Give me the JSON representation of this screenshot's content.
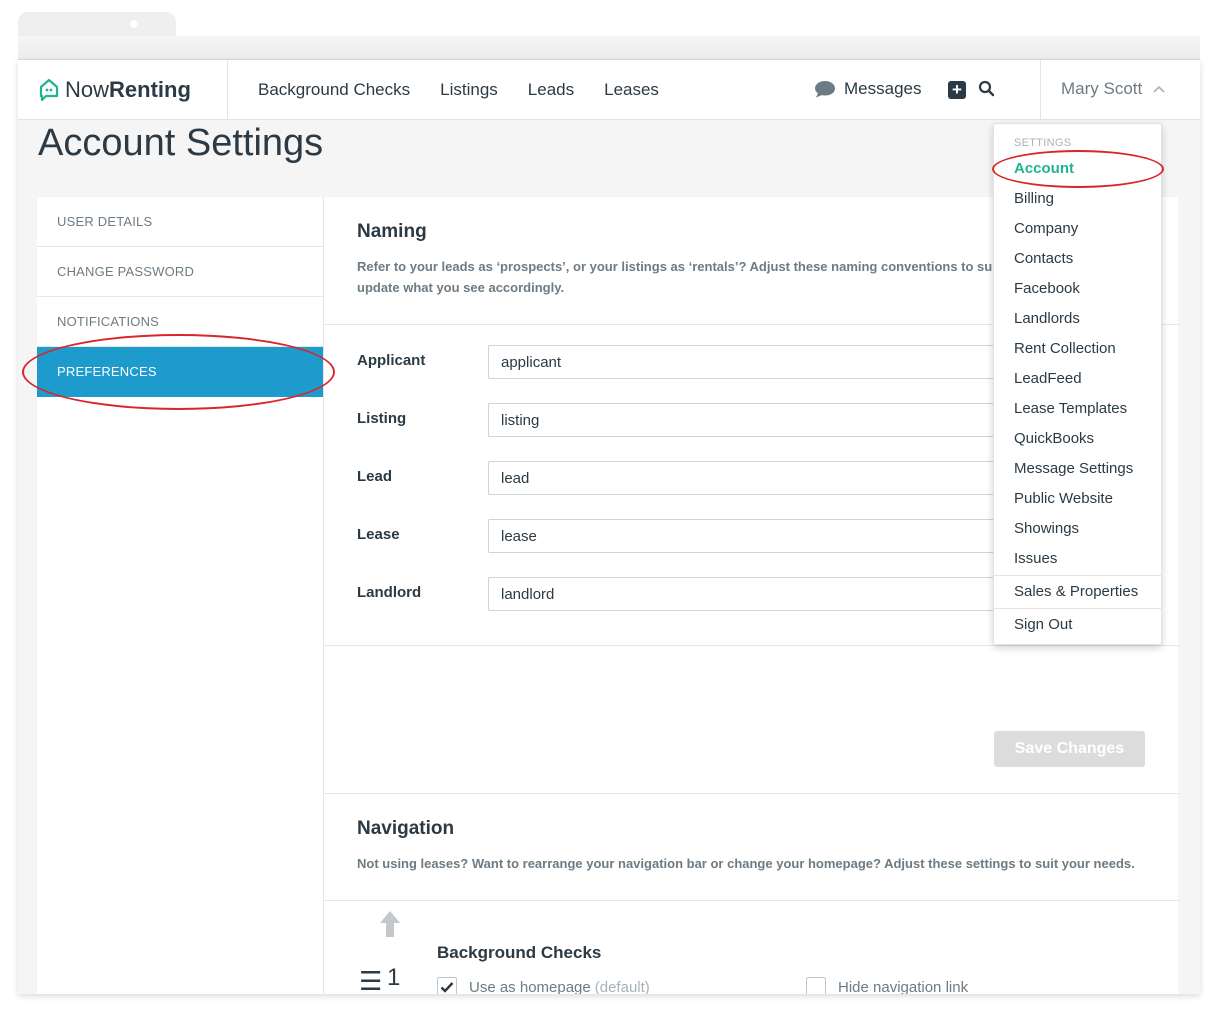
{
  "app": {
    "logo_now": "Now",
    "logo_renting": "Renting"
  },
  "topnav": {
    "links": [
      "Background Checks",
      "Listings",
      "Leads",
      "Leases"
    ],
    "messages_label": "Messages",
    "plus_icon": "plus-square-icon",
    "search_icon": "search-icon",
    "user_name": "Mary Scott"
  },
  "page": {
    "title": "Account Settings"
  },
  "sidebar": {
    "items": [
      {
        "label": "USER DETAILS"
      },
      {
        "label": "CHANGE PASSWORD"
      },
      {
        "label": "NOTIFICATIONS"
      },
      {
        "label": "PREFERENCES",
        "active": true
      }
    ]
  },
  "naming": {
    "title": "Naming",
    "desc_line1": "Refer to your leads as ‘prospects’, or your listings as ‘rentals’? Adjust these naming conventions to suit",
    "desc_line2": "update what you see accordingly.",
    "fields": [
      {
        "label": "Applicant",
        "value": "applicant"
      },
      {
        "label": "Listing",
        "value": "listing"
      },
      {
        "label": "Lead",
        "value": "lead"
      },
      {
        "label": "Lease",
        "value": "lease"
      },
      {
        "label": "Landlord",
        "value": "landlord"
      }
    ],
    "save_label": "Save Changes"
  },
  "navigation": {
    "title": "Navigation",
    "desc": "Not using leases? Want to rearrange your navigation bar or change your homepage? Adjust these settings to suit your needs.",
    "item": {
      "order": "1",
      "title": "Background Checks",
      "homepage_label": "Use as homepage",
      "homepage_default": "(default)",
      "homepage_checked": true,
      "hide_label": "Hide navigation link",
      "hide_checked": false
    }
  },
  "dropdown": {
    "header": "SETTINGS",
    "items": [
      "Account",
      "Billing",
      "Company",
      "Contacts",
      "Facebook",
      "Landlords",
      "Rent Collection",
      "LeadFeed",
      "Lease Templates",
      "QuickBooks",
      "Message Settings",
      "Public Website",
      "Showings",
      "Issues"
    ],
    "extra": [
      "Sales & Properties",
      "Sign Out"
    ],
    "active": "Account"
  },
  "colors": {
    "accent_blue": "#1e9bcd",
    "accent_green": "#1fb590",
    "annotation_red": "#d9262c"
  }
}
